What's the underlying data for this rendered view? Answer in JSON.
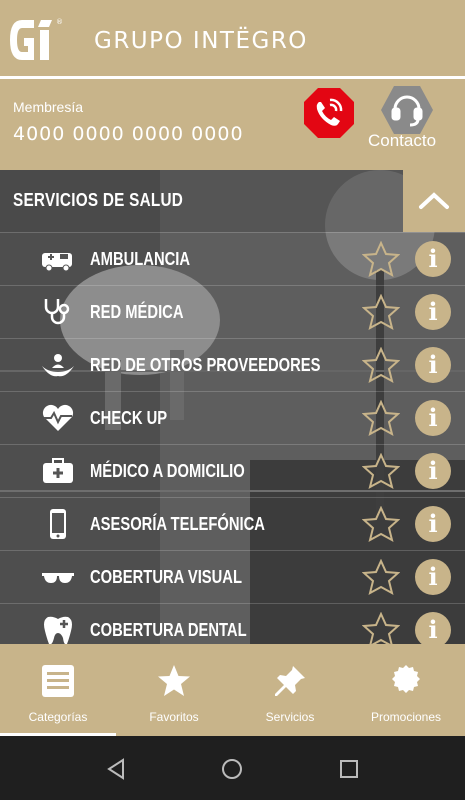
{
  "header": {
    "logo_text": "Gi",
    "brand": "GRUPO INTËGRO",
    "membership_label": "Membresía",
    "membership_number": "4000 0000 0000 0000",
    "emergency_icon": "phone-ringing-icon",
    "contact_icon": "headset-icon",
    "contact_label": "Contacto"
  },
  "section": {
    "title": "SERVICIOS DE SALUD",
    "collapse_icon": "chevron-up-icon",
    "items": [
      {
        "label": "AMBULANCIA",
        "icon": "ambulance-icon"
      },
      {
        "label": "RED MÉDICA",
        "icon": "stethoscope-icon"
      },
      {
        "label": "RED DE OTROS PROVEEDORES",
        "icon": "hands-people-icon"
      },
      {
        "label": "CHECK UP",
        "icon": "heart-pulse-icon"
      },
      {
        "label": "MÉDICO A DOMICILIO",
        "icon": "medical-kit-icon"
      },
      {
        "label": "ASESORÍA TELEFÓNICA",
        "icon": "smartphone-icon"
      },
      {
        "label": "COBERTURA VISUAL",
        "icon": "glasses-icon"
      },
      {
        "label": "COBERTURA DENTAL",
        "icon": "tooth-icon"
      }
    ]
  },
  "bottom_nav": [
    {
      "label": "Categorías",
      "icon": "list-icon",
      "active": true
    },
    {
      "label": "Favoritos",
      "icon": "star-icon"
    },
    {
      "label": "Servicios",
      "icon": "pin-icon"
    },
    {
      "label": "Promociones",
      "icon": "badge-icon"
    }
  ],
  "system_nav": {
    "back": "back-icon",
    "home": "home-icon",
    "recents": "recents-icon"
  },
  "colors": {
    "gold": "#c8b48a",
    "emergency_red": "#e30613",
    "contact_gray": "#8a8a8a"
  }
}
